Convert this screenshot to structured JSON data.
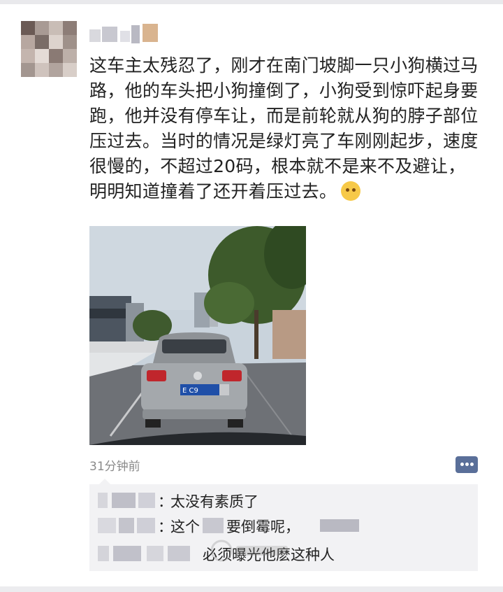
{
  "post": {
    "text": "这车主太残忍了，刚才在南门坡脚一只小狗横过马路，他的车头把小狗撞倒了，小狗受到惊吓起身要跑，他并没有停车让，而是前轮就从狗的脖子部位压过去。当时的情况是绿灯亮了车刚刚起步，速度很慢的，不超过20码，根本就不是来不及避让，明明知道撞着了还开着压过去。",
    "emoji": "face-emoji",
    "time": "31分钟前"
  },
  "photo": {
    "plate_text": "E C9"
  },
  "comments": [
    {
      "sep": "：",
      "text": "太没有素质了"
    },
    {
      "sep": "：",
      "text": "这个",
      "text_after": "要倒霉呢，"
    },
    {
      "sep": "",
      "text": "必须曝光他麽这种人"
    }
  ],
  "icons": {
    "comment": "comment-dots-icon"
  }
}
